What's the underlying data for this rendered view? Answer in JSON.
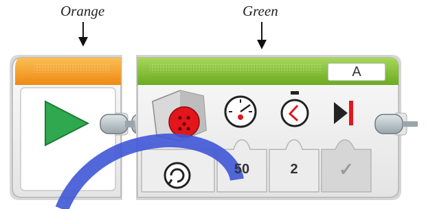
{
  "annotations": {
    "orange_label": "Orange",
    "green_label": "Green"
  },
  "start_block": {
    "color": "#f29a1e",
    "icon": "play-triangle-icon"
  },
  "motor_block": {
    "color": "#7fbc2a",
    "port": "A",
    "mode_icon": "mode-selector-icon",
    "parameters": [
      {
        "icon": "speedometer-icon",
        "value": "50"
      },
      {
        "icon": "timer-icon",
        "value": "2"
      },
      {
        "icon": "brake-stop-icon",
        "value": "✓"
      }
    ]
  },
  "colors": {
    "orange": "#f29a1e",
    "green": "#7fbc2a",
    "play": "#2fa84f",
    "motor_red": "#e3161b",
    "watermark": "#3f56d6"
  }
}
